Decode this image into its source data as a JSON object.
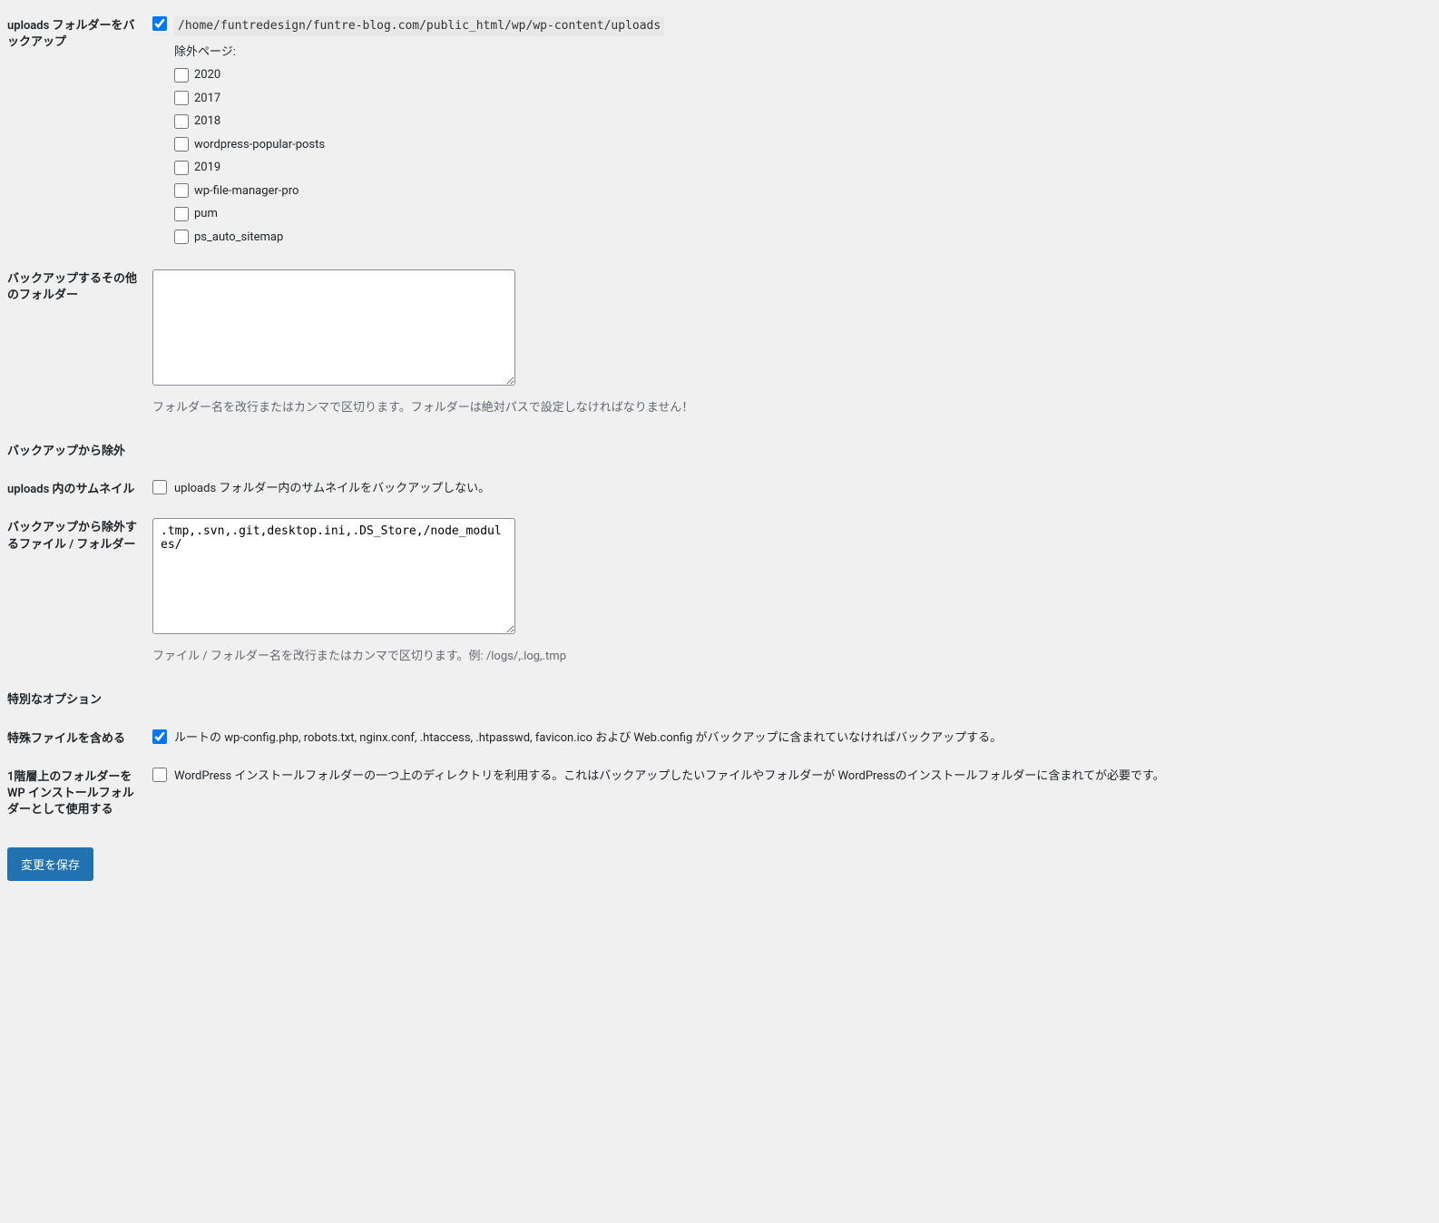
{
  "uploads_backup": {
    "label": "uploads フォルダーをバックアップ",
    "checked": true,
    "path": "/home/funtredesign/funtre-blog.com/public_html/wp/wp-content/uploads",
    "exclude_label": "除外ページ:",
    "exclude_items": [
      {
        "label": "2020",
        "checked": false
      },
      {
        "label": "2017",
        "checked": false
      },
      {
        "label": "2018",
        "checked": false
      },
      {
        "label": "wordpress-popular-posts",
        "checked": false
      },
      {
        "label": "2019",
        "checked": false
      },
      {
        "label": "wp-file-manager-pro",
        "checked": false
      },
      {
        "label": "pum",
        "checked": false
      },
      {
        "label": "ps_auto_sitemap",
        "checked": false
      }
    ]
  },
  "other_folders": {
    "label": "バックアップするその他のフォルダー",
    "value": "",
    "description": "フォルダー名を改行またはカンマで区切ります。フォルダーは絶対パスで設定しなければなりません！"
  },
  "exclude_section": {
    "label": "バックアップから除外"
  },
  "uploads_thumbnails": {
    "label": "uploads 内のサムネイル",
    "checked": false,
    "text": "uploads フォルダー内のサムネイルをバックアップしない。"
  },
  "exclude_files": {
    "label": "バックアップから除外するファイル / フォルダー",
    "value": ".tmp,.svn,.git,desktop.ini,.DS_Store,/node_modules/",
    "description": "ファイル / フォルダー名を改行またはカンマで区切ります。例: /logs/,.log,.tmp"
  },
  "special_section": {
    "label": "特別なオプション"
  },
  "special_files": {
    "label": "特殊ファイルを含める",
    "checked": true,
    "text": "ルートの wp-config.php, robots.txt, nginx.conf, .htaccess, .htpasswd, favicon.ico および Web.config がバックアップに含まれていなければバックアップする。"
  },
  "one_level_up": {
    "label": "1階層上のフォルダーを WP インストールフォルダーとして使用する",
    "checked": false,
    "text": "WordPress インストールフォルダーの一つ上のディレクトリを利用する。これはバックアップしたいファイルやフォルダーが WordPressのインストールフォルダーに含まれてが必要です。"
  },
  "submit": {
    "label": "変更を保存"
  }
}
